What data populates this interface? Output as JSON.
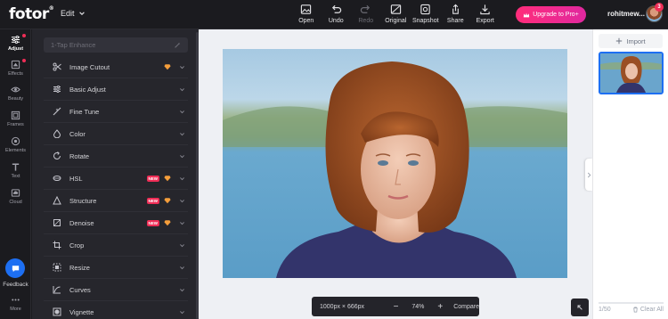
{
  "app": {
    "logo": "fotor",
    "logo_mark": "®",
    "menu_label": "Edit"
  },
  "toolbar": {
    "items": [
      {
        "label": "Open",
        "icon": "image-open-icon",
        "enabled": true
      },
      {
        "label": "Undo",
        "icon": "undo-icon",
        "enabled": true
      },
      {
        "label": "Redo",
        "icon": "redo-icon",
        "enabled": false
      },
      {
        "label": "Original",
        "icon": "compare-original-icon",
        "enabled": true
      },
      {
        "label": "Snapshot",
        "icon": "snapshot-icon",
        "enabled": true
      },
      {
        "label": "Share",
        "icon": "share-icon",
        "enabled": true
      },
      {
        "label": "Export",
        "icon": "download-icon",
        "enabled": true
      }
    ],
    "upgrade_label": "Upgrade to Pro+"
  },
  "user": {
    "name": "rohitmew...",
    "notifications": "3"
  },
  "rail": {
    "items": [
      {
        "label": "Adjust",
        "icon": "sliders-icon",
        "active": true,
        "dot": true
      },
      {
        "label": "Effects",
        "icon": "effects-icon",
        "active": false,
        "dot": true
      },
      {
        "label": "Beauty",
        "icon": "eye-icon",
        "active": false,
        "dot": false
      },
      {
        "label": "Frames",
        "icon": "frame-icon",
        "active": false,
        "dot": false
      },
      {
        "label": "Elements",
        "icon": "elements-icon",
        "active": false,
        "dot": false
      },
      {
        "label": "Text",
        "icon": "text-icon",
        "active": false,
        "dot": false
      },
      {
        "label": "Cloud",
        "icon": "cloud-icon",
        "active": false,
        "dot": false
      }
    ],
    "feedback_label": "Feedback",
    "more_label": "More"
  },
  "panel": {
    "search_placeholder": "1-Tap Enhance",
    "items": [
      {
        "label": "Image Cutout",
        "icon": "scissors-icon",
        "is_new": false,
        "pro": true
      },
      {
        "label": "Basic Adjust",
        "icon": "sliders-icon",
        "is_new": false,
        "pro": false
      },
      {
        "label": "Fine Tune",
        "icon": "fine-tune-icon",
        "is_new": false,
        "pro": false
      },
      {
        "label": "Color",
        "icon": "color-drop-icon",
        "is_new": false,
        "pro": false
      },
      {
        "label": "Rotate",
        "icon": "rotate-icon",
        "is_new": false,
        "pro": false
      },
      {
        "label": "HSL",
        "icon": "hsl-icon",
        "is_new": true,
        "pro": true
      },
      {
        "label": "Structure",
        "icon": "structure-icon",
        "is_new": true,
        "pro": true
      },
      {
        "label": "Denoise",
        "icon": "denoise-icon",
        "is_new": true,
        "pro": true
      },
      {
        "label": "Crop",
        "icon": "crop-icon",
        "is_new": false,
        "pro": false
      },
      {
        "label": "Resize",
        "icon": "resize-icon",
        "is_new": false,
        "pro": false
      },
      {
        "label": "Curves",
        "icon": "curves-icon",
        "is_new": false,
        "pro": false
      },
      {
        "label": "Vignette",
        "icon": "vignette-icon",
        "is_new": false,
        "pro": false
      }
    ],
    "new_badge": "NEW"
  },
  "canvas": {
    "dimensions": "1000px × 666px",
    "zoom": "74%",
    "zoom_minus": "−",
    "zoom_plus": "+",
    "compare_label": "Compare"
  },
  "right_panel": {
    "import_label": "Import",
    "page_count": "1/50",
    "clear_label": "Clear All"
  },
  "colors": {
    "accent": "#1d6ff2",
    "upgrade": "#ff2d7a",
    "new_badge": "#ef2d56",
    "gem": "#f59e3b"
  }
}
